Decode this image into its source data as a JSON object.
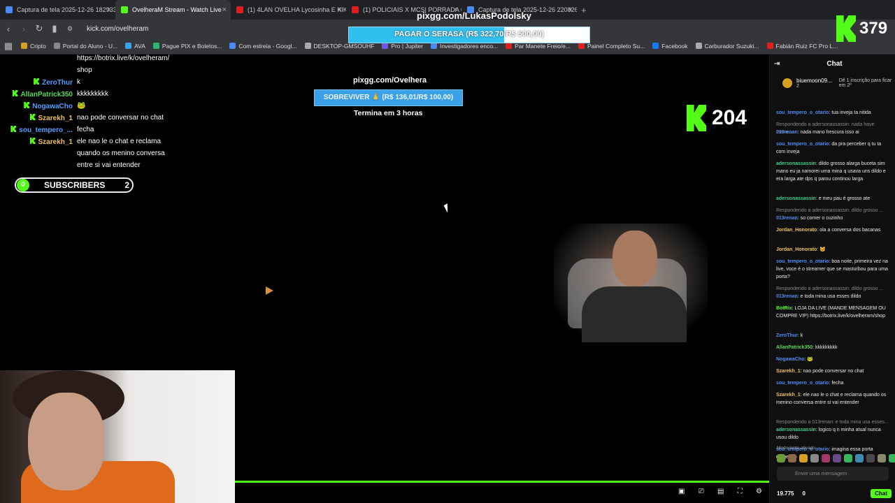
{
  "tabs": [
    {
      "title": "Captura de tela 2025-12-26 182933...",
      "active": false,
      "color": "#4a8af4"
    },
    {
      "title": "OvelheraM Stream - Watch Live",
      "active": true,
      "color": "#53fc18"
    },
    {
      "title": "(1) 4LAN OVELHA Lycosinha E KIKIR...",
      "active": false,
      "color": "#e02020"
    },
    {
      "title": "(1) POLICIAIS X MCS| PORRADA CO...",
      "active": false,
      "color": "#e02020"
    },
    {
      "title": "Captura de tela 2025-12-26 220826...",
      "active": false,
      "color": "#4a8af4"
    }
  ],
  "address": {
    "url": "kick.com/ovelheram"
  },
  "bookmarks": [
    "Cripto",
    "Portal do Aluno - U...",
    "AVA",
    "Pague PIX e Boletos...",
    "Com estreia - Googl...",
    "DESKTOP-GMSOUHF",
    "Pro | Jupiter",
    "Investigadores enco...",
    "Par Manete Freio/e...",
    "Painel Completo Su...",
    "Facebook",
    "Carburador Suzuki...",
    "Fabián Ruiz FC Pro L..."
  ],
  "top_overlay": {
    "pix": "pixgg.com/LukasPodolsky",
    "goal_text": "PAGAR O SERASA (R$ 322,70/R$ 500,00)",
    "goal_fraction": 0.645
  },
  "kick_badge": {
    "count": "379"
  },
  "stream": {
    "chat_overlay": [
      {
        "name": "",
        "text": "https://botrix.live/k/ovelheram/",
        "k": false,
        "nc": "#fff"
      },
      {
        "name": "",
        "text": "shop",
        "k": false,
        "nc": "#fff"
      },
      {
        "name": "ZeroThur",
        "text": "k",
        "k": true,
        "nc": "#53a0ff"
      },
      {
        "name": "AllanPatrick350",
        "text": "kkkkkkkkk",
        "k": true,
        "nc": "#5bd95b"
      },
      {
        "name": "NogawaCho",
        "text": "🐸",
        "k": true,
        "nc": "#53a0ff"
      },
      {
        "name": "Szarekh_1",
        "text": "nao pode conversar no chat",
        "k": true,
        "nc": "#f0c060"
      },
      {
        "name": "sou_tempero_...",
        "text": "fecha",
        "k": true,
        "nc": "#53a0ff"
      },
      {
        "name": "Szarekh_1",
        "text": "ele nao le o chat e reclama",
        "k": true,
        "nc": "#f0c060"
      },
      {
        "name": "",
        "text": "quando os menino conversa",
        "k": false,
        "nc": "#fff"
      },
      {
        "name": "",
        "text": "entre si vai entender",
        "k": false,
        "nc": "#fff"
      }
    ],
    "subscribers": {
      "left": "0",
      "label": "SUBSCRIBERS",
      "right": "2"
    },
    "pix": "pixgg.com/Ovelhera",
    "goal": "SOBREVIVER 🙏 (R$ 136,01/R$ 100,00)",
    "ends": "Termina em 3 horas",
    "viewer_badge": "204"
  },
  "sidebar": {
    "title": "Chat",
    "pinned_user": "biuemoon09...",
    "pinned_count": "2",
    "pinned_note": "Dê 1 inscrição para ficar em 2º",
    "messages": [
      {
        "user": "sou_tempero_o_otario",
        "text": "tua inveja ta nitida",
        "c": "#4f8ef5"
      },
      {
        "reply": "Respondendo a adersonassassin: nada have mano..."
      },
      {
        "user": "013renan",
        "text": "nada mano frescura isso ai",
        "c": "#4f8ef5"
      },
      {
        "user": "sou_tempero_o_otario",
        "text": "da pra perceber q tu ta com inveja",
        "c": "#4f8ef5"
      },
      {
        "user": "adersonassassin",
        "text": "dildo grosso alarga buceta sim mano eu ja namorei uma mina q usava uns dildo e era larga ate dps q parou continou larga",
        "c": "#3ccf8e"
      },
      {
        "user": "adersonassassin",
        "text": "e meu pau é grosso ate",
        "c": "#3ccf8e"
      },
      {
        "reply": "Respondendo a adersonassassin: dildo grosso ..."
      },
      {
        "user": "013renan",
        "text": "so comer o cuzinho",
        "c": "#4f8ef5"
      },
      {
        "user": "Jordan_Honorato",
        "text": "ola a conversa dos bacanas",
        "c": "#f0c060"
      },
      {
        "user": "Jordan_Honorato",
        "text": "🐱",
        "c": "#f0c060"
      },
      {
        "user": "sou_tempero_o_otario",
        "text": "boa noite, primeira vez na live, voce é o streamer que se masturbou para uma porta?",
        "c": "#4f8ef5"
      },
      {
        "reply": "Respondendo a adersonassassin: dildo grosso ..."
      },
      {
        "user": "013renan",
        "text": "e toda mina usa esses dildo",
        "c": "#4f8ef5"
      },
      {
        "user": "BotRix",
        "text": "LOJA DA LIVE (MANDE MENSAGEM OU COMPRE VIP) https://botrix.live/k/ovelheram/shop",
        "c": "#53fc18"
      },
      {
        "user": "ZeroThur",
        "text": "k",
        "c": "#4f8ef5"
      },
      {
        "user": "AllanPatrick350",
        "text": "kkkkkkkkk",
        "c": "#5bd95b"
      },
      {
        "user": "NogawaCho",
        "text": "🐸",
        "c": "#4f8ef5"
      },
      {
        "user": "Szarekh_1",
        "text": "nao pode conversar no chat",
        "c": "#f0c060"
      },
      {
        "user": "sou_tempero_o_otario",
        "text": "fecha",
        "c": "#4f8ef5"
      },
      {
        "user": "Szarekh_1",
        "text": "ele nao le o chat e reclama quando os menino conversa entre si vai entender",
        "c": "#f0c060"
      },
      {
        "reply": "Respondendo a 013renan: e toda mina usa esses..."
      },
      {
        "user": "adersonassassin",
        "text": "logico q n minha atual nunca usou dildo",
        "c": "#3ccf8e"
      },
      {
        "user": "sou_tempero_o_otario",
        "text": "imagina essa porta rangendo",
        "c": "#4f8ef5"
      }
    ],
    "slow_mode": "Modo lento ativado",
    "input_placeholder": "Envie uma mensagem",
    "viewers": "19.775",
    "other_count": "0",
    "chat_button": "Chat"
  },
  "colors": {
    "kick_green": "#53fc18",
    "goal_blue": "#2fc0ef",
    "sob_blue": "#3aa0e8"
  }
}
